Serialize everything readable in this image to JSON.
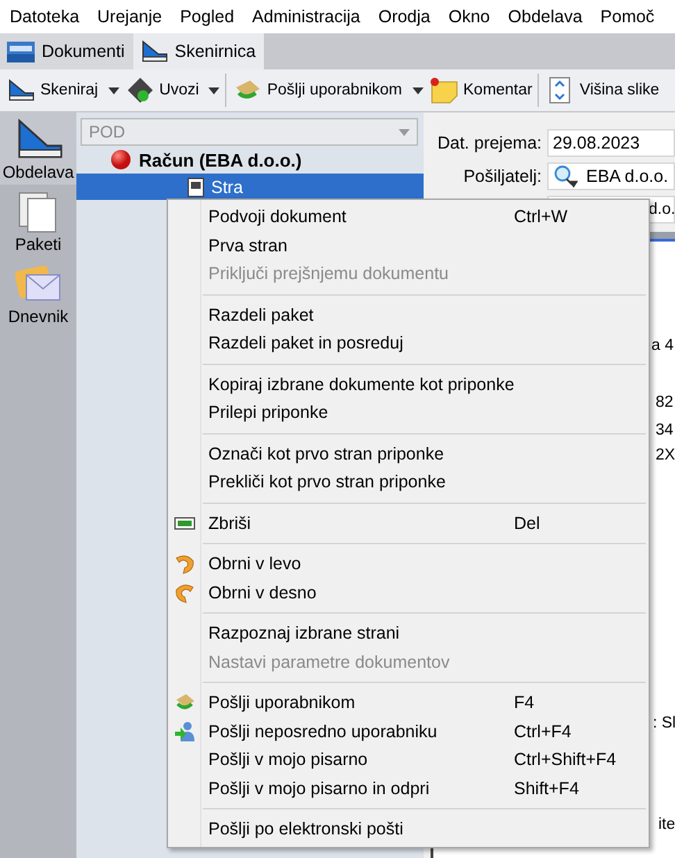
{
  "menubar": [
    "Datoteka",
    "Urejanje",
    "Pogled",
    "Administracija",
    "Orodja",
    "Okno",
    "Obdelava",
    "Pomoč"
  ],
  "tabs": [
    {
      "label": "Dokumenti",
      "selected": false
    },
    {
      "label": "Skenirnica",
      "selected": true
    }
  ],
  "toolbar": [
    [
      {
        "label": "Skeniraj",
        "dropdown": true
      },
      {
        "label": "Uvozi",
        "dropdown": true
      }
    ],
    [
      {
        "label": "Pošlji uporabnikom",
        "dropdown": true
      },
      {
        "label": "Komentar",
        "dropdown": false
      }
    ],
    [
      {
        "label": "Višina slike",
        "dropdown": false
      }
    ]
  ],
  "nav": [
    {
      "label": "Obdelava",
      "selected": true
    },
    {
      "label": "Paketi",
      "selected": false
    },
    {
      "label": "Dnevnik",
      "selected": false
    }
  ],
  "tree": {
    "filter": "POD",
    "items": [
      {
        "label": "Račun (EBA d.o.o.)",
        "selected": false,
        "children": [
          {
            "label": "Stra",
            "selected": true
          }
        ]
      }
    ]
  },
  "form": [
    {
      "label": "Dat. prejema:",
      "value": "29.08.2023",
      "kind": "text"
    },
    {
      "label": "Pošiljatelj:",
      "value": "EBA d.o.o.",
      "kind": "lookup"
    },
    {
      "value": "d.o.",
      "kind": "text"
    }
  ],
  "preview_fragments": [
    "a 4",
    "82",
    "34",
    "2X",
    ": Sl",
    "ite"
  ],
  "context_menu": [
    [
      {
        "label": "Podvoji dokument",
        "shortcut": "Ctrl+W",
        "disabled": false
      },
      {
        "label": "Prva stran",
        "disabled": false
      },
      {
        "label": "Priključi prejšnjemu dokumentu",
        "disabled": true
      }
    ],
    [
      {
        "label": "Razdeli paket",
        "disabled": false
      },
      {
        "label": "Razdeli paket in posreduj",
        "disabled": false
      }
    ],
    [
      {
        "label": "Kopiraj izbrane dokumente kot priponke",
        "disabled": false
      },
      {
        "label": "Prilepi priponke",
        "disabled": false
      }
    ],
    [
      {
        "label": "Označi kot prvo stran priponke",
        "disabled": false
      },
      {
        "label": "Prekliči kot prvo stran priponke",
        "disabled": false
      }
    ],
    [
      {
        "label": "Zbriši",
        "shortcut": "Del",
        "kind": "delete",
        "disabled": false
      }
    ],
    [
      {
        "label": "Obrni v levo",
        "kind": "rotate-left",
        "disabled": false
      },
      {
        "label": "Obrni v desno",
        "kind": "rotate-right",
        "disabled": false
      }
    ],
    [
      {
        "label": "Razpoznaj izbrane strani",
        "disabled": false
      },
      {
        "label": "Nastavi parametre dokumentov",
        "disabled": true
      }
    ],
    [
      {
        "label": "Pošlji uporabnikom",
        "shortcut": "F4",
        "kind": "send",
        "disabled": false
      },
      {
        "label": "Pošlji neposredno uporabniku",
        "shortcut": "Ctrl+F4",
        "kind": "user",
        "disabled": false
      },
      {
        "label": "Pošlji v mojo pisarno",
        "shortcut": "Ctrl+Shift+F4",
        "disabled": false
      },
      {
        "label": "Pošlji v mojo pisarno in odpri",
        "shortcut": "Shift+F4",
        "disabled": false
      }
    ],
    [
      {
        "label": "Pošlji po elektronski pošti",
        "disabled": false
      }
    ]
  ]
}
